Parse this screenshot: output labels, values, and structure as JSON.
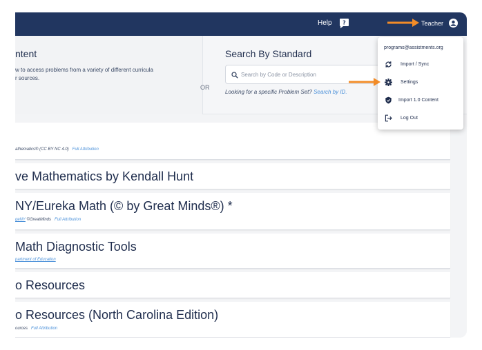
{
  "header": {
    "help_label": "Help",
    "user_label": "Teacher",
    "bar_color": "#213660"
  },
  "browse": {
    "title": "ntent",
    "desc_line1": "w to access problems from a variety of different curricula",
    "desc_line2": "r sources."
  },
  "or_label": "OR",
  "standard_search": {
    "title": "Search By Standard",
    "placeholder": "Search by Code or Description",
    "specific_text": "Looking for a specific Problem Set?",
    "specific_link": "Search by ID."
  },
  "curricula": [
    {
      "title": "",
      "sub": "athematics® (CC BY NC 4.0)",
      "link": "Full Attribution"
    },
    {
      "title": "ve Mathematics by Kendall Hunt",
      "sub": "",
      "link": ""
    },
    {
      "title": "NY/Eureka Math (© by Great Minds®) *",
      "sub_link": "geNY",
      "sub": "©GreatMinds",
      "link": "Full Attribution"
    },
    {
      "title": "Math Diagnostic Tools",
      "sub_link": "partment of Education",
      "sub": "",
      "link": ""
    },
    {
      "title": "o Resources",
      "sub": "",
      "link": ""
    },
    {
      "title": "o Resources (North Carolina Edition)",
      "sub": "ources",
      "link": "Full Attribution"
    }
  ],
  "user_menu": {
    "email": "programs@assistments.org",
    "items": [
      {
        "label": "Import / Sync",
        "icon": "sync-icon"
      },
      {
        "label": "Settings",
        "icon": "gear-icon"
      },
      {
        "label": "Import 1.0 Content",
        "icon": "shield-icon"
      },
      {
        "label": "Log Out",
        "icon": "logout-icon"
      }
    ]
  },
  "arrow_color": "#f28c28",
  "link_color": "#4a90d9"
}
